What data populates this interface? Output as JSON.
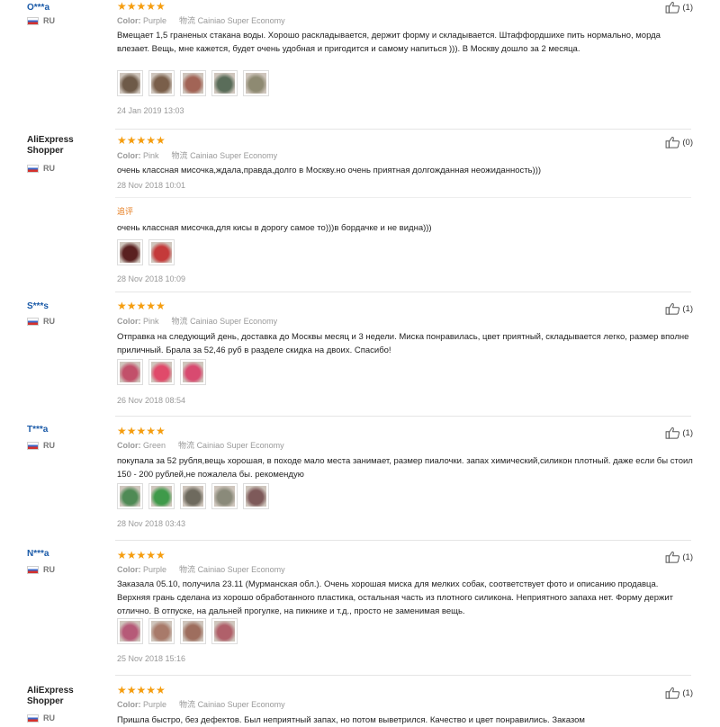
{
  "labels": {
    "color": "Color:",
    "shipping_method": "物流",
    "shipping_name": "Cainiao Super Economy",
    "additional": "追评"
  },
  "colors": {
    "star": "#f59d0f",
    "author_link": "#1a5aa8",
    "date": "#999999"
  },
  "reviews": [
    {
      "author": "O***a",
      "country": "RU",
      "stars": "★★★★★",
      "color": "Purple",
      "text": "Вмещает 1,5 граненых стакана воды. Хорошо раскладывается, держит форму и складывается. Штаффордшихе пить нормально, морда влезает. Вещь, мне кажется, будет очень удобная и пригодится и самому напиться ))). В Москву дошло за 2 месяца.",
      "photos": [
        "#6e5a48",
        "#7a5f4a",
        "#a26456",
        "#5a6d5a",
        "#8e8a72"
      ],
      "date": "24 Jan 2019 13:03",
      "helpful": "(1)"
    },
    {
      "author": "AliExpress Shopper",
      "country": "RU",
      "stars": "★★★★★",
      "color": "Pink",
      "text": "очень классная мисочка,ждала,правда,долго в Москву.но очень приятная долгожданная неожиданность)))",
      "photos": [],
      "date": "28 Nov 2018 10:01",
      "helpful": "(0)",
      "additional_text": "очень классная мисочка,для кисы в дорогу самое то)))в бордачке и не видна)))",
      "additional_photos": [
        "#5a2020",
        "#c43a3a"
      ],
      "additional_date": "28 Nov 2018 10:09"
    },
    {
      "author": "S***s",
      "country": "RU",
      "stars": "★★★★★",
      "color": "Pink",
      "text": "Отправка на следующий день, доставка до Москвы месяц и 3 недели. Миска понравилась, цвет приятный, складывается легко, размер вполне приличный. Брала за 52,46 руб в разделе скидка на двоих. Спасибо!",
      "photos": [
        "#c2506a",
        "#e04a6a",
        "#d84a70"
      ],
      "date": "26 Nov 2018 08:54",
      "helpful": "(1)"
    },
    {
      "author": "T***a",
      "country": "RU",
      "stars": "★★★★★",
      "color": "Green",
      "text": "покупала за 52 рубля,вещь хорошая, в походе мало места занимает, размер пиалочки. запах химический,силикон плотный. даже если бы стоил 150 - 200 рублей,не пожалела бы. рекомендую",
      "photos": [
        "#4f8a55",
        "#3f9a4a",
        "#6e6a5e",
        "#8a8a7a",
        "#7e5a5a"
      ],
      "date": "28 Nov 2018 03:43",
      "helpful": "(1)"
    },
    {
      "author": "N***a",
      "country": "RU",
      "stars": "★★★★★",
      "color": "Purple",
      "text": "Заказала 05.10, получила 23.11 (Мурманская обл.). Очень хорошая миска для мелких собак, соответствует фото и описанию продавца. Верхняя грань сделана из хорошо обработанного пластика, остальная часть из плотного силикона. Неприятного запаха нет. Форму держит отлично. В отпуске, на дальней прогулке, на пикнике и т.д., просто не заменимая вещь.",
      "photos": [
        "#b65a78",
        "#a87a6a",
        "#9e6e5e",
        "#b0606a"
      ],
      "date": "25 Nov 2018 15:16",
      "helpful": "(1)"
    },
    {
      "author": "AliExpress Shopper",
      "country": "RU",
      "stars": "★★★★★",
      "color": "Purple",
      "text": "Пришла быстро, без дефектов. Был неприятный запах, но потом выветрился. Качество и цвет понравились. Заказом",
      "photos": [],
      "date": "",
      "helpful": "(1)"
    }
  ]
}
